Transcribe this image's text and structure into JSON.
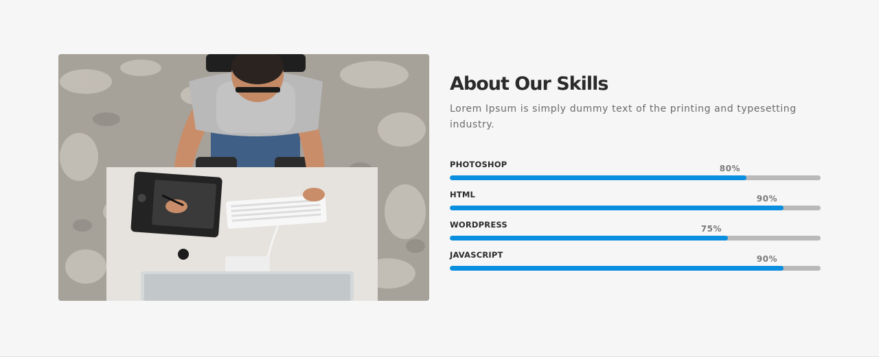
{
  "section": {
    "title": "About Our Skills",
    "description": "Lorem Ipsum is simply dummy text of the printing and typesetting industry."
  },
  "photo": {
    "subject": "man-working-at-desk-photo"
  },
  "skills": [
    {
      "label": "PHOTOSHOP",
      "percent_text": "80%",
      "value": 0.8
    },
    {
      "label": "HTML",
      "percent_text": "90%",
      "value": 0.9
    },
    {
      "label": "WORDPRESS",
      "percent_text": "75%",
      "value": 0.75
    },
    {
      "label": "JAVASCRIPT",
      "percent_text": "90%",
      "value": 0.9
    }
  ],
  "colors": {
    "bar_fill": "#0a8fe0",
    "bar_track": "#b9b9b9",
    "title": "#2a2a2a",
    "background": "#f6f6f6"
  }
}
